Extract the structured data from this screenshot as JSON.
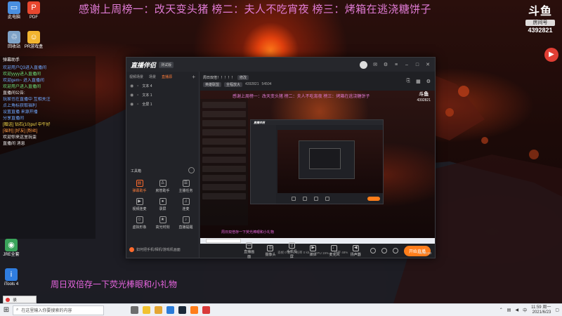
{
  "overlay": {
    "top_banner": "感谢上周榜一：改天变头猪  榜二：夫人不吃宵夜  榜三：烤箱在逃浇糖饼子",
    "bottom_caption": "周日双倍存一下荧光棒眼和小礼物",
    "douyu_mark": "斗鱼",
    "room_label": "房间号",
    "room_id": "4392821"
  },
  "desktop_icons": [
    {
      "label": "此电脑",
      "icon": "computer-icon",
      "color": "#4a8fe0"
    },
    {
      "label": "回收站",
      "icon": "recycle-bin-icon",
      "color": "#7fa3c8"
    },
    {
      "label": "PDF",
      "icon": "pdf-icon",
      "color": "#e8472f"
    },
    {
      "label": "PR游戏盒",
      "icon": "game-box-icon",
      "color": "#f2b530"
    },
    {
      "label": "iTools 4",
      "icon": "itools-icon",
      "color": "#2f7de0"
    },
    {
      "label": "JRE全套",
      "icon": "app-icon",
      "color": "#3aa35a"
    }
  ],
  "chat": {
    "title": "弹幕助手",
    "lines": [
      {
        "text": "欢迎用户Q3进入直播间",
        "cls": "c-blue"
      },
      {
        "text": "欢迎yyyy进入直播间",
        "cls": "c-green"
      },
      {
        "text": "欢迎gem~ 进入直播间",
        "cls": "c-blue"
      },
      {
        "text": "欢迎用户进入直播间",
        "cls": "c-green"
      },
      {
        "text": "直播间公告:",
        "cls": "c-white"
      },
      {
        "text": "玩家也在直播中 互相关注",
        "cls": "c-blue"
      },
      {
        "text": "点上角标获取福利",
        "cls": "c-blue"
      },
      {
        "text": "设置直播 来源开播",
        "cls": "c-blue"
      },
      {
        "text": "分享直播间",
        "cls": "c-blue"
      },
      {
        "text": "[赠送] 钻石(10)puf 中午好",
        "cls": "c-yellow"
      },
      {
        "text": "[福利] [好友] [粉丝]",
        "cls": "c-orange"
      },
      {
        "text": "欢迎你来这里玩耍",
        "cls": "c-white"
      },
      {
        "text": "直播间 消息",
        "cls": "c-white"
      }
    ]
  },
  "app": {
    "logo": "直播伴侣",
    "version": "测试版",
    "side_tabs": [
      "视频场景",
      "场景",
      "直播源"
    ],
    "active_tab_index": 2,
    "sources": [
      "文本 4",
      "文本 1",
      "全屏 1"
    ],
    "quick_label": "工具箱",
    "tools": [
      {
        "label": "弹幕助手",
        "icon": "chat-icon",
        "hot": true
      },
      {
        "label": "房管助手",
        "icon": "user-icon",
        "hot": false
      },
      {
        "label": "主播任务",
        "icon": "task-icon",
        "hot": false
      },
      {
        "label": "视频连麦",
        "icon": "video-icon",
        "hot": false
      },
      {
        "label": "录屏",
        "icon": "record-icon",
        "hot": false
      },
      {
        "label": "连麦",
        "icon": "mic-icon",
        "hot": false
      },
      {
        "label": "虚拟形象",
        "icon": "avatar-icon",
        "hot": false
      },
      {
        "label": "高光时刻",
        "icon": "star-icon",
        "hot": false
      },
      {
        "label": "直播提醒",
        "icon": "bell-icon",
        "hot": false
      }
    ],
    "side_bottom": "如何把手机/相机/游戏机画面",
    "room_title": "周日双倍！！！！！",
    "edit_label": "修改",
    "room_chips": [
      "英雄联盟",
      "全程放大"
    ],
    "room_stats": [
      "4392821",
      "54504"
    ],
    "preview_banner": "感谢上周榜一：改天变头猪 榜二：夫人不吃宵夜 榜三：烤箱在逃浇糖饼子",
    "preview_caption": "周日双倍存一下荧光棒眼和小礼物",
    "preview_logo": "斗鱼",
    "preview_room": "4392821",
    "toolbar": [
      {
        "label": "直播画面",
        "icon": "screen-icon"
      },
      {
        "label": "摄像头",
        "icon": "camera-icon"
      },
      {
        "label": "手机投屏",
        "icon": "phone-icon"
      },
      {
        "label": "媒体",
        "icon": "media-icon"
      },
      {
        "label": "麦克风",
        "icon": "microphone-icon"
      },
      {
        "label": "扬声器",
        "icon": "speaker-icon"
      }
    ],
    "start_button": "开始直播",
    "status": [
      "丢帧 0 帧",
      "码率 0 kb",
      "CPU 19%",
      "内存 48%"
    ],
    "timer": "00:00:00"
  },
  "taskbar": {
    "search_placeholder": "在这里输入你要搜索的内容",
    "clock_time": "11:59 周一",
    "clock_date": "2021/6/23",
    "lang": "中",
    "small_window": "录"
  }
}
